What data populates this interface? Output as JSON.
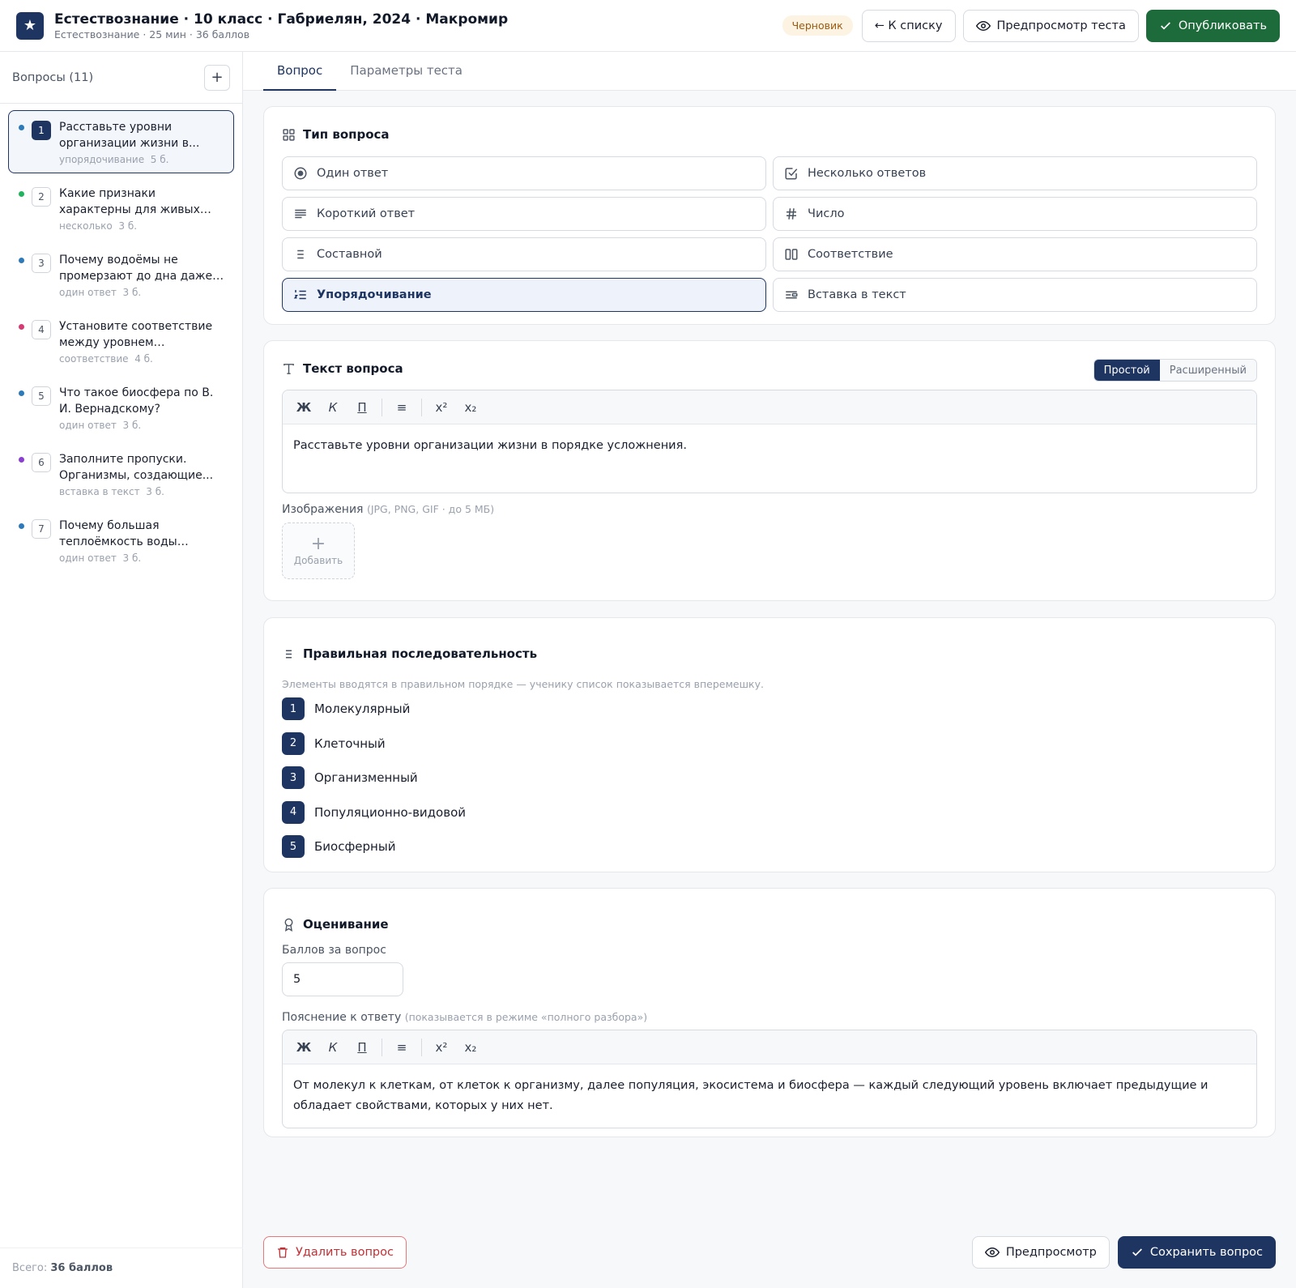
{
  "header": {
    "title": "Естествознание · 10 класс · Габриелян, 2024 · Макромир",
    "subtitle": "Естествознание · 25 мин · 36 баллов",
    "status_badge": "Черновик",
    "back_button": "← К списку",
    "preview_test_button": "Предпросмотр теста",
    "publish_button": "Опубликовать"
  },
  "sidebar": {
    "title": "Вопросы (11)",
    "add_button": "+",
    "items": [
      {
        "num": "1",
        "text": "Расставьте уровни организации жизни в...",
        "type": "упорядочивание",
        "points": "5 б.",
        "dot": "#2e7ab8"
      },
      {
        "num": "2",
        "text": "Какие признаки характерны для живых систем? Выбери...",
        "type": "несколько",
        "points": "3 б.",
        "dot": "#22b35e"
      },
      {
        "num": "3",
        "text": "Почему водоёмы не промерзают до дна даже в...",
        "type": "один ответ",
        "points": "3 б.",
        "dot": "#2e7ab8"
      },
      {
        "num": "4",
        "text": "Установите соответствие между уровнем организаци...",
        "type": "соответствие",
        "points": "4 б.",
        "dot": "#d63c74"
      },
      {
        "num": "5",
        "text": "Что такое биосфера по В. И. Вернадскому?",
        "type": "один ответ",
        "points": "3 б.",
        "dot": "#2e7ab8"
      },
      {
        "num": "6",
        "text": "Заполните пропуски. Организмы, создающие...",
        "type": "вставка в текст",
        "points": "3 б.",
        "dot": "#8a3fd1"
      },
      {
        "num": "7",
        "text": "Почему большая теплоёмкость воды важна...",
        "type": "один ответ",
        "points": "3 б.",
        "dot": "#2e7ab8"
      }
    ],
    "footer_prefix": "Всего: ",
    "footer_total": "36 баллов"
  },
  "tabs": [
    "Вопрос",
    "Параметры теста"
  ],
  "question_type": {
    "title": "Тип вопроса",
    "options": [
      "Один ответ",
      "Несколько ответов",
      "Короткий ответ",
      "Число",
      "Составной",
      "Соответствие",
      "Упорядочивание",
      "Вставка в текст"
    ],
    "selected": "Упорядочивание"
  },
  "question_text": {
    "title": "Текст вопроса",
    "modes": [
      "Простой",
      "Расширенный"
    ],
    "toolbar": [
      "Ж",
      "К",
      "П",
      "≡",
      "x²",
      "x₂"
    ],
    "content": "Расставьте уровни организации жизни в порядке усложнения.",
    "images_label": "Изображения",
    "images_hint": "(JPG, PNG, GIF · до 5 МБ)",
    "add_plus": "+",
    "add_image": "Добавить"
  },
  "sequence": {
    "title": "Правильная последовательность",
    "hint": "Элементы вводятся в правильном порядке — ученику список показывается вперемешку.",
    "items": [
      {
        "num": "1",
        "text": "Молекулярный"
      },
      {
        "num": "2",
        "text": "Клеточный"
      },
      {
        "num": "3",
        "text": "Организменный"
      },
      {
        "num": "4",
        "text": "Популяционно-видовой"
      },
      {
        "num": "5",
        "text": "Биосферный"
      }
    ]
  },
  "grading": {
    "title": "Оценивание",
    "points_label": "Баллов за вопрос",
    "points_value": "5",
    "explanation_label": "Пояснение к ответу",
    "explanation_hint": "(показывается в режиме «полного разбора»)",
    "toolbar": [
      "Ж",
      "К",
      "П",
      "≡",
      "x²",
      "x₂"
    ],
    "explanation": "От молекул к клеткам, от клеток к организму, далее популяция, экосистема и биосфера — каждый следующий уровень включает предыдущие и обладает свойствами, которых у них нет."
  },
  "footer": {
    "delete_button": "Удалить вопрос",
    "preview_button": "Предпросмотр",
    "save_button": "Сохранить вопрос"
  }
}
